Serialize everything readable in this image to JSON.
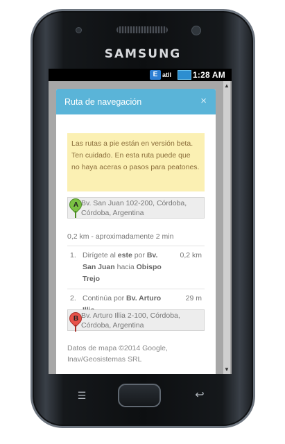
{
  "device": {
    "brand": "SAMSUNG"
  },
  "statusbar": {
    "network": "E",
    "signal": "atll",
    "time": "1:28 AM"
  },
  "modal": {
    "title": "Ruta de navegación",
    "close": "×",
    "alert": "Las rutas a pie están en versión beta. Ten cuidado. En esta ruta puede que no haya aceras o pasos para peatones.",
    "origin": {
      "pin": "A",
      "address": "Bv. San Juan 102-200, Córdoba, Córdoba, Argentina"
    },
    "summary": "0,2 km - aproximadamente 2 min",
    "steps": [
      {
        "num": "1.",
        "parts": [
          "Dirígete al ",
          "este",
          " por ",
          "Bv. San Juan",
          " hacia ",
          "Obispo Trejo"
        ],
        "distance": "0,2 km"
      },
      {
        "num": "2.",
        "parts": [
          "Continúa por ",
          "Bv. Arturo Illia",
          "."
        ],
        "distance": "29 m"
      }
    ],
    "destination": {
      "pin": "B",
      "address": "Bv. Arturo Illia 2-100, Córdoba, Córdoba, Argentina"
    },
    "copyright": "Datos de mapa ©2014 Google, Inav/Geosistemas SRL"
  },
  "keys": {
    "menu_glyph": "☰",
    "back_glyph": "↩"
  },
  "colors": {
    "header": "#5ab4d8",
    "alert_bg": "#fbf0b3",
    "pin_a": "#7ac143",
    "pin_b": "#e8534a"
  }
}
